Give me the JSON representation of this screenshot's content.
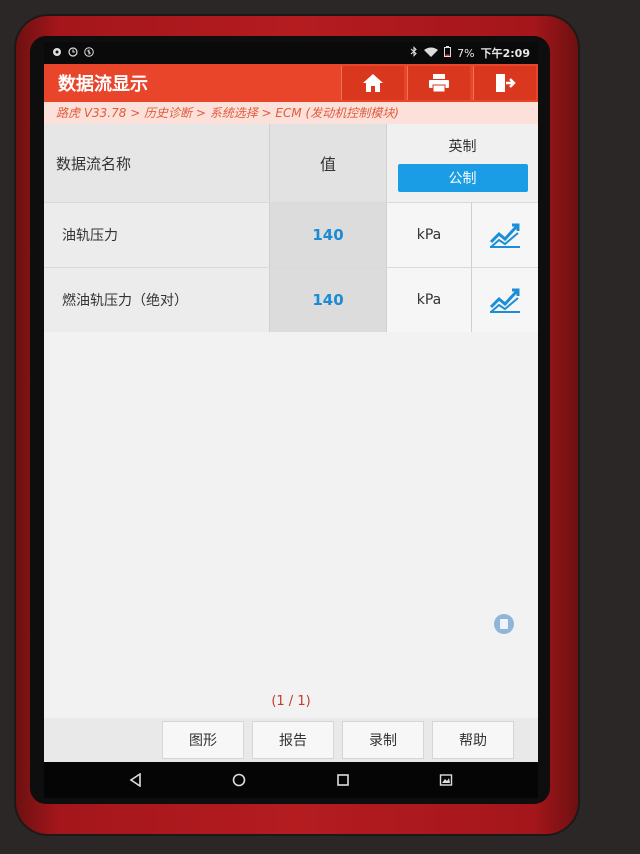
{
  "status_bar": {
    "battery_percent": "7%",
    "time": "下午2:09",
    "icons": [
      "notification-icon",
      "clock-icon",
      "bluetooth-icon",
      "wifi-icon",
      "battery-icon"
    ]
  },
  "header": {
    "title": "数据流显示",
    "buttons": [
      "home-icon",
      "print-icon",
      "exit-icon"
    ],
    "accent": "#e8452b"
  },
  "breadcrumb": "路虎 V33.78 > 历史诊断 > 系统选择 > ECM (发动机控制模块)",
  "table": {
    "headers": {
      "name": "数据流名称",
      "value": "值",
      "unit_imperial": "英制",
      "unit_metric": "公制"
    },
    "rows": [
      {
        "name": "油轨压力",
        "value": "140",
        "unit": "kPa",
        "icon": "graph-icon"
      },
      {
        "name": "燃油轨压力（绝对）",
        "value": "140",
        "unit": "kPa",
        "icon": "graph-icon"
      }
    ],
    "value_color": "#1c8bd6",
    "selected_unit_color": "#1a9de4"
  },
  "pager": "(1 / 1)",
  "bottom_buttons": [
    "图形",
    "报告",
    "录制",
    "帮助"
  ],
  "nav_bar": [
    "back-icon",
    "home-circle-icon",
    "recents-icon",
    "screenshot-icon"
  ]
}
